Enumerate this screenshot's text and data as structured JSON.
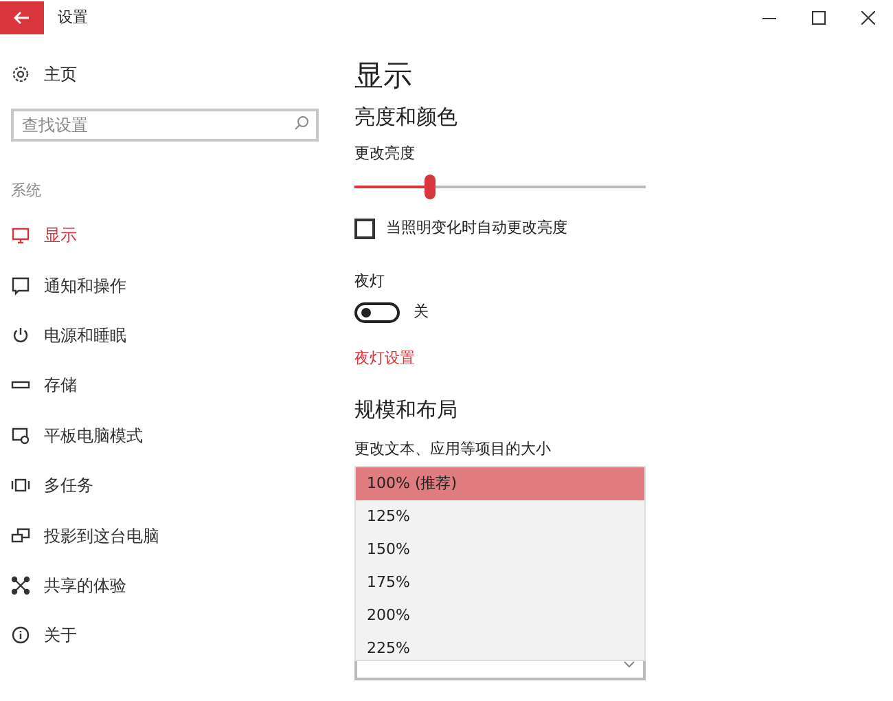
{
  "window": {
    "title": "设置"
  },
  "sidebar": {
    "home": "主页",
    "search": {
      "placeholder": "查找设置"
    },
    "section": "系统",
    "items": [
      {
        "label": "显示",
        "selected": true
      },
      {
        "label": "通知和操作",
        "selected": false
      },
      {
        "label": "电源和睡眠",
        "selected": false
      },
      {
        "label": "存储",
        "selected": false
      },
      {
        "label": "平板电脑模式",
        "selected": false
      },
      {
        "label": "多任务",
        "selected": false
      },
      {
        "label": "投影到这台电脑",
        "selected": false
      },
      {
        "label": "共享的体验",
        "selected": false
      },
      {
        "label": "关于",
        "selected": false
      }
    ]
  },
  "content": {
    "title": "显示",
    "brightness_section": "亮度和颜色",
    "brightness": {
      "label": "更改亮度",
      "level": 0.26
    },
    "auto_brightness": {
      "label": "当照明变化时自动更改亮度",
      "checked": false
    },
    "night_light": {
      "label": "夜灯",
      "on": false,
      "state_text": "关"
    },
    "night_light_link": "夜灯设置",
    "scale_section": "规模和布局",
    "scale": {
      "label": "更改文本、应用等项目的大小",
      "options": [
        {
          "label": "100% (推荐)",
          "selected": true
        },
        {
          "label": "125%",
          "selected": false
        },
        {
          "label": "150%",
          "selected": false
        },
        {
          "label": "175%",
          "selected": false
        },
        {
          "label": "200%",
          "selected": false
        },
        {
          "label": "225%",
          "selected": false
        }
      ]
    }
  }
}
